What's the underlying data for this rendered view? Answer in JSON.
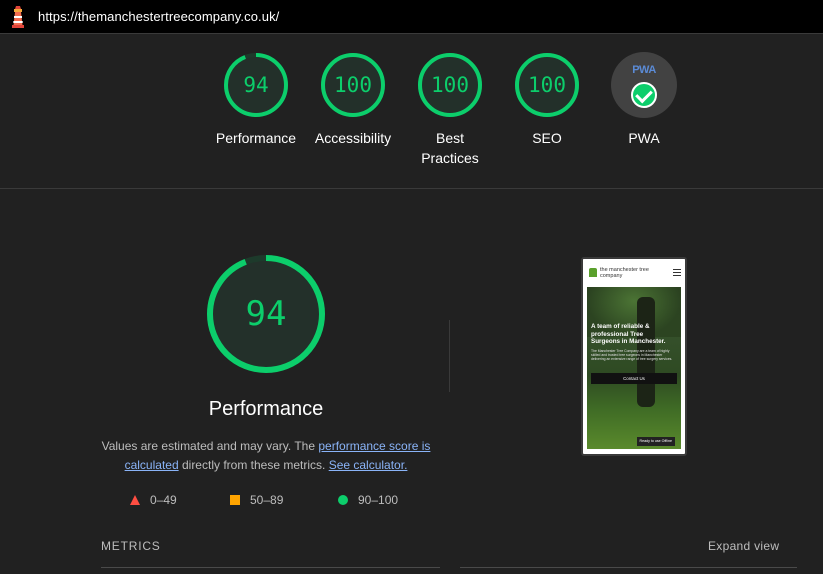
{
  "topbar": {
    "url": "https://themanchestertreecompany.co.uk/",
    "icon": "lighthouse-icon"
  },
  "colors": {
    "pass": "#0cce6b",
    "average": "#ffa400",
    "fail": "#ff4e42",
    "background": "#212121"
  },
  "categories": [
    {
      "label": "Performance",
      "score": 94
    },
    {
      "label": "Accessibility",
      "score": 100
    },
    {
      "label": "Best Practices",
      "score": 100
    },
    {
      "label": "SEO",
      "score": 100
    },
    {
      "label": "PWA",
      "badge": "PWA",
      "icon": "pwa-check-icon"
    }
  ],
  "main": {
    "score": 94,
    "title": "Performance",
    "desc_text_1": "Values are estimated and may vary. The ",
    "desc_link_1": "performance score is calculated",
    "desc_text_2": " directly from these metrics. ",
    "desc_link_2": "See calculator."
  },
  "legend": [
    {
      "range": "0–49",
      "icon": "triangle-icon"
    },
    {
      "range": "50–89",
      "icon": "square-icon"
    },
    {
      "range": "90–100",
      "icon": "circle-icon"
    }
  ],
  "screenshot": {
    "brand": "the manchester tree company",
    "heading": "A team of reliable & professional Tree Surgeons in Manchester.",
    "body": "The Manchester Tree Company are a team of highly skilled and trusted tree surgeons in Manchester delivering an extensive range of tree surgery services.",
    "button": "Contact Us",
    "offline": "Ready to use Offline"
  },
  "metrics": {
    "label": "METRICS",
    "expand": "Expand view"
  }
}
